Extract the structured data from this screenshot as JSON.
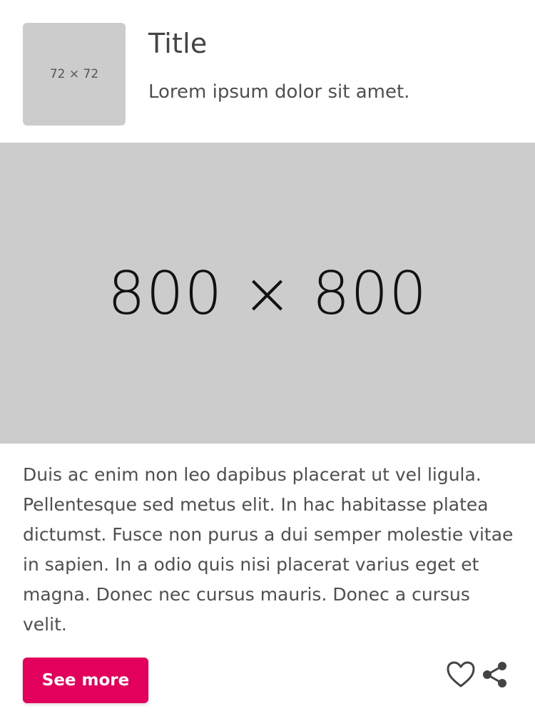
{
  "header": {
    "thumbnail_label": "72 × 72",
    "title": "Title",
    "subtitle": "Lorem ipsum dolor sit amet."
  },
  "hero": {
    "label": "800 × 800"
  },
  "content": {
    "body": "Duis ac enim non leo dapibus placerat ut vel ligula. Pellentesque sed metus elit. In hac habitasse platea dictumst. Fusce non purus a dui semper molestie vitae in sapien. In a odio quis nisi placerat varius eget et magna. Donec nec cursus mauris. Donec a cursus velit."
  },
  "actions": {
    "see_more_label": "See more",
    "favorite_icon": "heart-outline-icon",
    "share_icon": "share-icon"
  },
  "colors": {
    "accent": "#e3005c",
    "placeholder": "#cccccc",
    "text": "#4f4f4f"
  }
}
